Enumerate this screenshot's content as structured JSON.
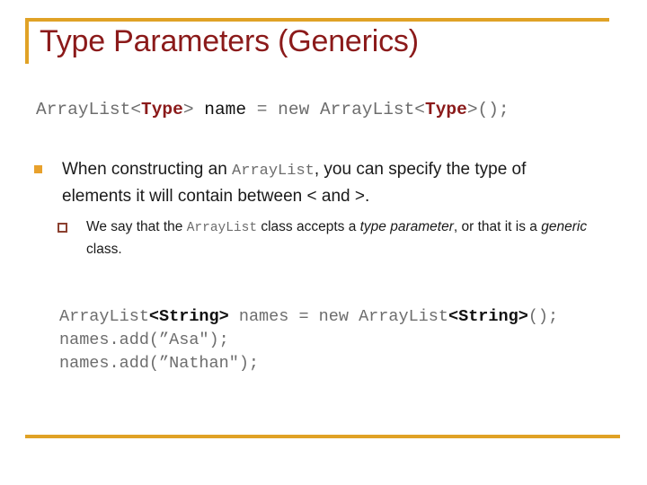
{
  "slide": {
    "title": "Type Parameters (Generics)",
    "accent_color": "#E0A226",
    "title_color": "#8B1A1A",
    "bullet_marker_color": "#E8A12C",
    "subbullet_marker_color": "#8B4030"
  },
  "code_signature": {
    "seg1": "ArrayList<",
    "seg2": "Type",
    "seg3": "> ",
    "seg4": "name",
    "seg5": " = ",
    "seg6": "new ArrayList<",
    "seg7": "Type",
    "seg8": ">();"
  },
  "bullets": [
    {
      "marker": "filled-square",
      "text_pre": "When constructing an ",
      "code": "ArrayList",
      "text_mid": ", you can specify the type of elements it will contain between ",
      "lt": "<",
      "text_and": " and ",
      "gt": ">",
      "text_end": "."
    }
  ],
  "subbullets": [
    {
      "marker": "hollow-square",
      "text_pre": "We say that the ",
      "code": "ArrayList",
      "text_mid": " class accepts a ",
      "italic1": "type parameter",
      "text_mid2": ", or that it is a ",
      "italic2": "generic",
      "text_end": " class."
    }
  ],
  "code_block": {
    "line1": {
      "seg1": "ArrayList",
      "seg2": "<String>",
      "seg3": " names = new ArrayList",
      "seg4": "<String>",
      "seg5": "();"
    },
    "line2": "names.add(”Asa\");",
    "line3": "names.add(”Nathan\");"
  }
}
